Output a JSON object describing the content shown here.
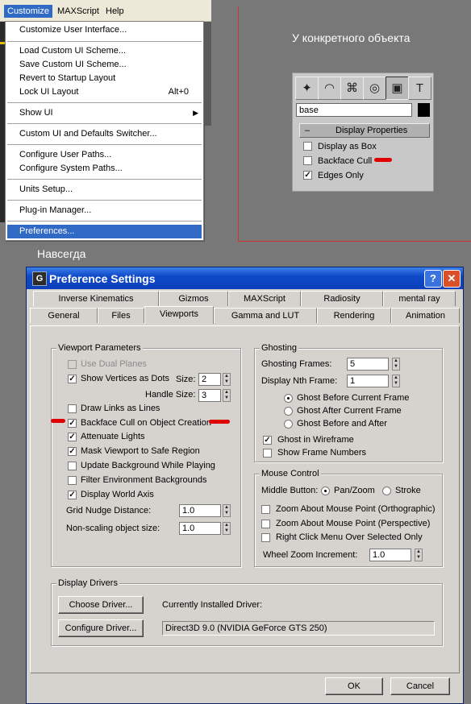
{
  "menu": {
    "bar": [
      "Customize",
      "MAXScript",
      "Help"
    ],
    "items": [
      {
        "label": "Customize User Interface..."
      },
      {
        "label": "Load Custom UI Scheme..."
      },
      {
        "label": "Save Custom UI Scheme..."
      },
      {
        "label": "Revert to Startup Layout"
      },
      {
        "label": "Lock UI Layout",
        "accel": "Alt+0"
      },
      {
        "label": "Show UI",
        "submenu": "▶"
      },
      {
        "label": "Custom UI and Defaults Switcher..."
      },
      {
        "label": "Configure User Paths..."
      },
      {
        "label": "Configure System Paths..."
      },
      {
        "label": "Units Setup..."
      },
      {
        "label": "Plug-in Manager..."
      },
      {
        "label": "Preferences..."
      }
    ]
  },
  "object_panel": {
    "caption": "У конкретного объекта",
    "name_value": "base",
    "rollout_title": "Display Properties",
    "rollout_toggle": "–",
    "options": [
      {
        "label": "Display as Box",
        "checked": false
      },
      {
        "label": "Backface Cull",
        "checked": false
      },
      {
        "label": "Edges Only",
        "checked": true
      }
    ]
  },
  "caption_forever": "Навсегда",
  "dialog": {
    "title": "Preference Settings",
    "help_label": "?",
    "close_label": "✕",
    "tabs_row1": [
      "Inverse Kinematics",
      "Gizmos",
      "MAXScript",
      "Radiosity",
      "mental ray"
    ],
    "tabs_row2": [
      "General",
      "Files",
      "Viewports",
      "Gamma and LUT",
      "Rendering",
      "Animation"
    ],
    "active_tab": "Viewports",
    "viewport_params": {
      "title": "Viewport Parameters",
      "use_dual_planes": "Use Dual Planes",
      "show_vertices": "Show Vertices as Dots",
      "size_label": "Size:",
      "size_value": "2",
      "handle_size_label": "Handle Size:",
      "handle_size_value": "3",
      "draw_links": "Draw Links as Lines",
      "backface_cull": "Backface Cull on Object Creation",
      "attenuate": "Attenuate Lights",
      "mask_viewport": "Mask Viewport to Safe Region",
      "update_bg": "Update Background While Playing",
      "filter_env": "Filter Environment Backgrounds",
      "world_axis": "Display World Axis",
      "grid_nudge_label": "Grid Nudge Distance:",
      "grid_nudge_value": "1.0",
      "nonscaling_label": "Non-scaling object size:",
      "nonscaling_value": "1.0"
    },
    "ghosting": {
      "title": "Ghosting",
      "frames_label": "Ghosting Frames:",
      "frames_value": "5",
      "nth_label": "Display Nth Frame:",
      "nth_value": "1",
      "before": "Ghost Before Current Frame",
      "after": "Ghost After Current Frame",
      "before_after": "Ghost Before and After",
      "wireframe": "Ghost in Wireframe",
      "frame_numbers": "Show Frame Numbers"
    },
    "mouse_control": {
      "title": "Mouse Control",
      "middle_label": "Middle Button:",
      "pan_zoom": "Pan/Zoom",
      "stroke": "Stroke",
      "zoom_ortho": "Zoom About Mouse Point (Orthographic)",
      "zoom_persp": "Zoom About Mouse Point (Perspective)",
      "right_click": "Right Click Menu Over Selected Only",
      "wheel_label": "Wheel Zoom Increment:",
      "wheel_value": "1.0"
    },
    "drivers": {
      "title": "Display Drivers",
      "choose": "Choose Driver...",
      "configure": "Configure Driver...",
      "installed_label": "Currently Installed Driver:",
      "installed_value": "Direct3D 9.0 (NVIDIA GeForce GTS 250)"
    },
    "ok": "OK",
    "cancel": "Cancel"
  },
  "colors": {
    "accent": "#316ac5",
    "annotation": "#e00000",
    "titlebar": "#0f4ac8"
  }
}
